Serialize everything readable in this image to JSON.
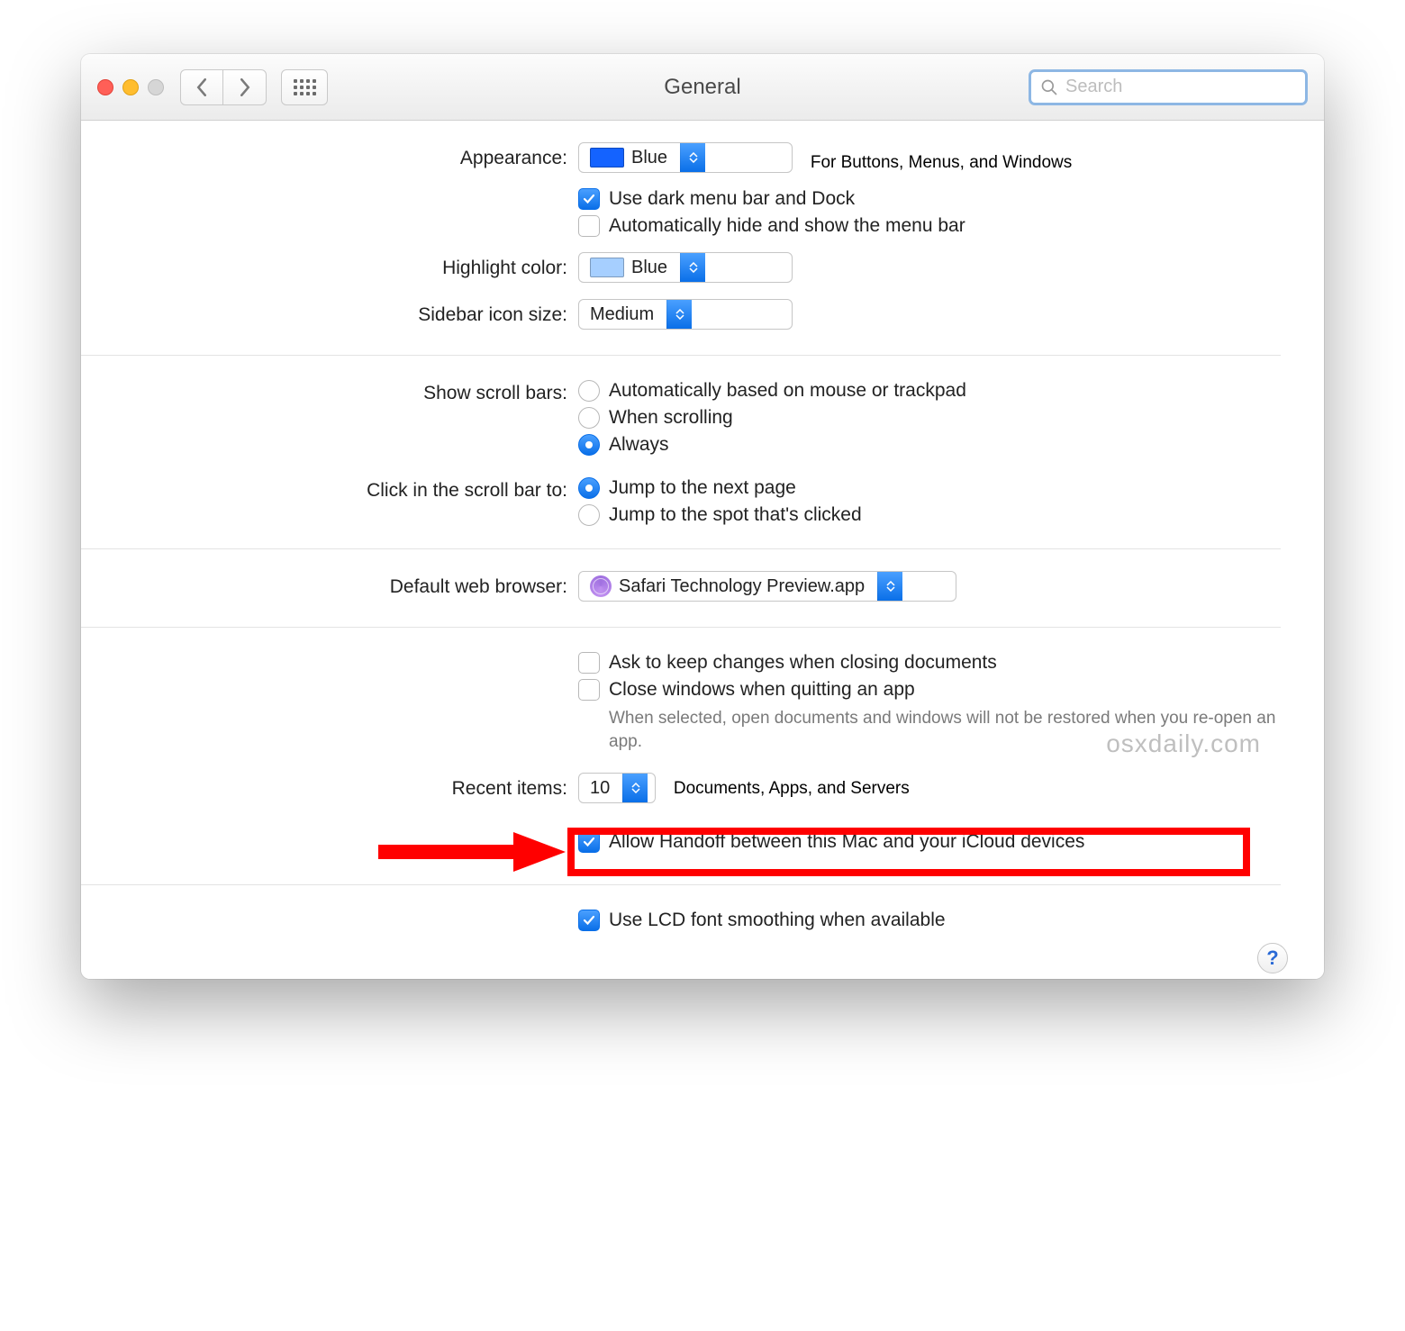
{
  "window": {
    "title": "General",
    "search_placeholder": "Search"
  },
  "appearance": {
    "label": "Appearance:",
    "value": "Blue",
    "hint": "For Buttons, Menus, and Windows",
    "dark_menu": "Use dark menu bar and Dock",
    "auto_hide_menu": "Automatically hide and show the menu bar"
  },
  "highlight": {
    "label": "Highlight color:",
    "value": "Blue"
  },
  "sidebar_size": {
    "label": "Sidebar icon size:",
    "value": "Medium"
  },
  "scrollbars": {
    "label": "Show scroll bars:",
    "opt_auto": "Automatically based on mouse or trackpad",
    "opt_scroll": "When scrolling",
    "opt_always": "Always"
  },
  "click_scroll": {
    "label": "Click in the scroll bar to:",
    "opt_next": "Jump to the next page",
    "opt_spot": "Jump to the spot that's clicked"
  },
  "browser": {
    "label": "Default web browser:",
    "value": "Safari Technology Preview.app"
  },
  "documents": {
    "ask_keep": "Ask to keep changes when closing documents",
    "close_quit": "Close windows when quitting an app",
    "close_quit_hint": "When selected, open documents and windows will not be restored when you re-open an app."
  },
  "recent": {
    "label": "Recent items:",
    "value": "10",
    "hint": "Documents, Apps, and Servers"
  },
  "handoff": "Allow Handoff between this Mac and your iCloud devices",
  "lcd": "Use LCD font smoothing when available",
  "help": "?",
  "watermark": "osxdaily.com"
}
